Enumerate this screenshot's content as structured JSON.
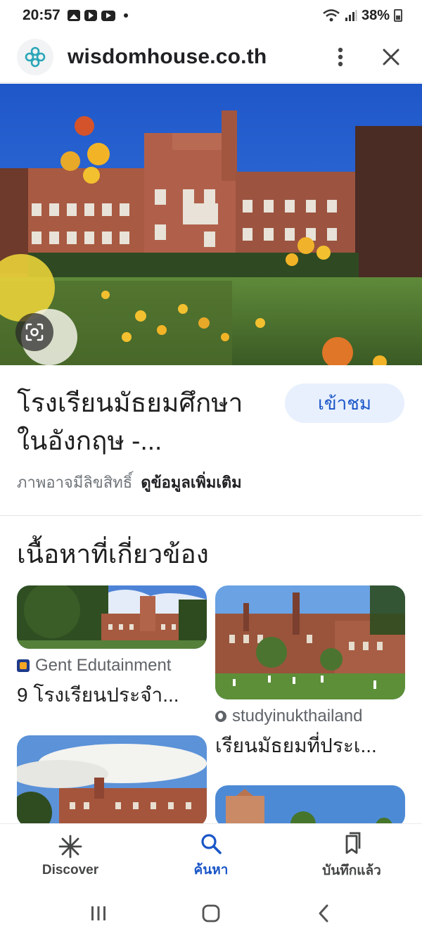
{
  "status_bar": {
    "time": "20:57",
    "battery": "38%"
  },
  "header": {
    "site": "wisdomhouse.co.th",
    "icons": [
      "site-logo-icon",
      "more-vert-icon",
      "close-icon"
    ]
  },
  "result": {
    "title_line1": "โรงเรียนมัธยมศึกษา",
    "title_line2": "ในอังกฤษ -...",
    "visit_label": "เข้าชม",
    "copyright_text": "ภาพอาจมีลิขสิทธิ์",
    "more_info": "ดูข้อมูลเพิ่มเติม"
  },
  "related": {
    "heading": "เนื้อหาที่เกี่ยวข้อง",
    "items": [
      {
        "source": "Gent Edutainment",
        "title": "9 โรงเรียนประจำ..."
      },
      {
        "source": "studyinukthailand",
        "title": "เรียนมัธยมที่ประเ..."
      }
    ]
  },
  "bottom_nav": {
    "items": [
      {
        "label": "Discover",
        "icon": "asterisk-icon"
      },
      {
        "label": "ค้นหา",
        "icon": "search-icon",
        "active": true
      },
      {
        "label": "บันทึกแล้ว",
        "icon": "bookmark-icon"
      }
    ]
  },
  "colors": {
    "accent": "#1a56c8",
    "chip_bg": "#e8f0fe"
  }
}
